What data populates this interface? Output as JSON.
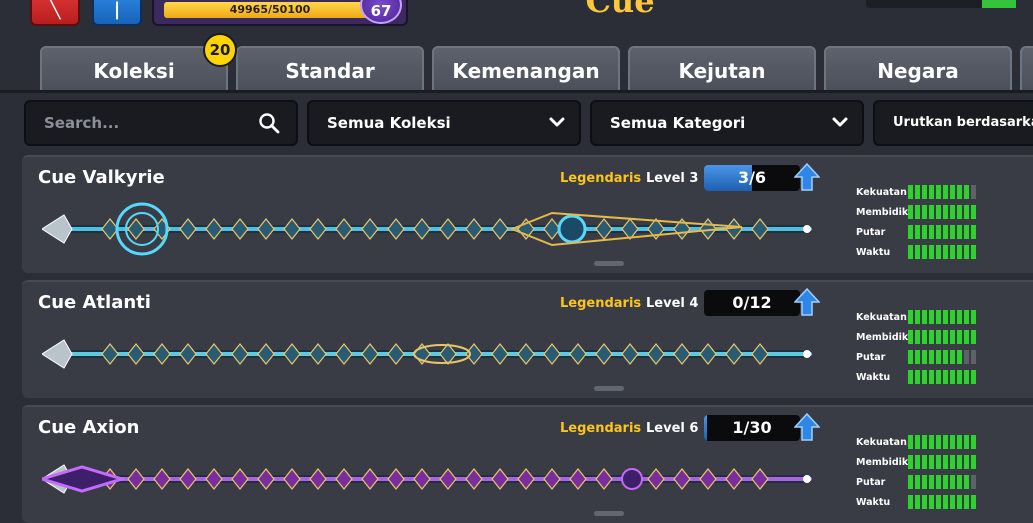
{
  "header": {
    "xp_text": "49965/50100",
    "xp_fraction": 0.997,
    "level": "67",
    "title": "Cue",
    "colors": {
      "accent": "#ffc83a",
      "xp": "#f0a915",
      "badge": "#ffd400"
    }
  },
  "tabs": [
    {
      "label": "Koleksi",
      "badge": "20"
    },
    {
      "label": "Standar"
    },
    {
      "label": "Kemenangan"
    },
    {
      "label": "Kejutan"
    },
    {
      "label": "Negara"
    }
  ],
  "filters": {
    "search_placeholder": "Search...",
    "collection": "Semua Koleksi",
    "category": "Semua Kategori",
    "sort": "Urutkan berdasarkan"
  },
  "stat_labels": [
    "Kekuatan",
    "Membidik",
    "Putar",
    "Waktu"
  ],
  "cues": [
    {
      "name": "Cue Valkyrie",
      "rarity": "Legendaris",
      "level": "Level 3",
      "progress_text": "3/6",
      "progress_fraction": 0.5,
      "glow": "#57d8ff",
      "stats": [
        9,
        10,
        10,
        10
      ]
    },
    {
      "name": "Cue Atlanti",
      "rarity": "Legendaris",
      "level": "Level 4",
      "progress_text": "0/12",
      "progress_fraction": 0,
      "glow": "#66e6ff",
      "stats": [
        10,
        10,
        8,
        10
      ]
    },
    {
      "name": "Cue Axion",
      "rarity": "Legendaris",
      "level": "Level 6",
      "progress_text": "1/30",
      "progress_fraction": 0.033,
      "glow": "#c56bff",
      "stats": [
        10,
        10,
        9,
        10
      ]
    }
  ]
}
